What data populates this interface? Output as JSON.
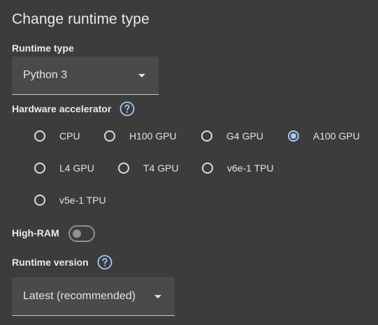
{
  "dialog": {
    "title": "Change runtime type"
  },
  "runtime_type": {
    "label": "Runtime type",
    "selected": "Python 3"
  },
  "hardware_accelerator": {
    "label": "Hardware accelerator",
    "help_icon": "help-circle-icon",
    "options": [
      {
        "label": "CPU",
        "checked": false
      },
      {
        "label": "H100 GPU",
        "checked": false
      },
      {
        "label": "G4 GPU",
        "checked": false
      },
      {
        "label": "A100 GPU",
        "checked": true
      },
      {
        "label": "L4 GPU",
        "checked": false
      },
      {
        "label": "T4 GPU",
        "checked": false
      },
      {
        "label": "v6e-1 TPU",
        "checked": false
      },
      {
        "label": "v5e-1 TPU",
        "checked": false
      }
    ]
  },
  "high_ram": {
    "label": "High-RAM",
    "enabled": false
  },
  "runtime_version": {
    "label": "Runtime version",
    "help_icon": "help-circle-icon",
    "selected": "Latest (recommended)"
  },
  "colors": {
    "background": "#3c3c3c",
    "select_fill": "#4a4a4a",
    "accent": "#a8c7fa",
    "text": "#e3e3e3"
  }
}
